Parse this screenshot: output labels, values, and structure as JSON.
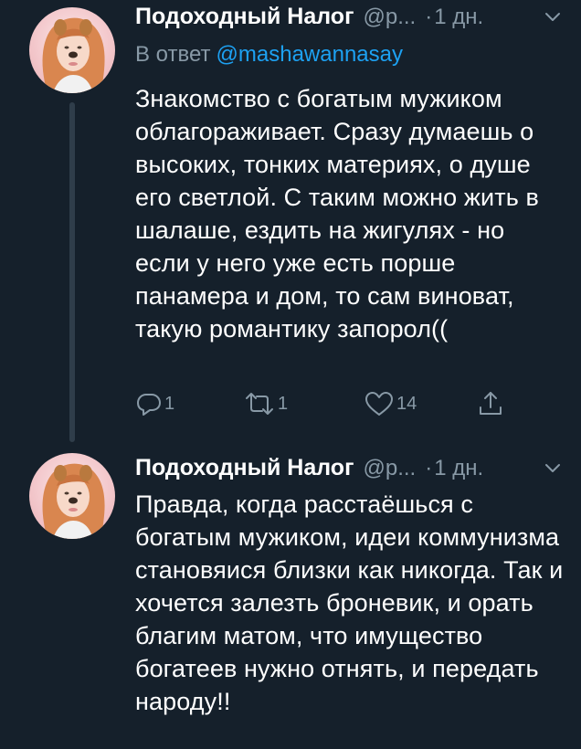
{
  "tweets": [
    {
      "display_name": "Подоходный Налог",
      "handle": "@p...",
      "dot": "·",
      "time": "1 дн.",
      "reply_prefix": "В ответ",
      "reply_mention": "@mashawannasay",
      "text": "Знакомство с богатым мужиком облагораживает. Сразу думаешь о высоких, тонких материях, о душе его светлой. С таким можно жить в шалаше, ездить на жигулях - но если у него уже есть порше панамера и дом, то сам виноват, такую романтику запорол((",
      "reply_count": "1",
      "retweet_count": "1",
      "like_count": "14"
    },
    {
      "display_name": "Подоходный Налог",
      "handle": "@p...",
      "dot": "·",
      "time": "1 дн.",
      "text": "Правда, когда расстаёшься с богатым мужиком, идеи коммунизма становяися близки как никогда. Так и хочется залезть броневик, и орать благим матом, что имущество богатеев нужно отнять, и передать народу!!"
    }
  ],
  "colors": {
    "background": "#15202b",
    "text": "#ffffff",
    "secondary": "#8899a6",
    "accent": "#1da1f2",
    "thread_line": "#2f3d4a"
  },
  "icons": {
    "reply": "reply-icon",
    "retweet": "retweet-icon",
    "like": "heart-icon",
    "share": "share-icon",
    "menu": "chevron-down-icon"
  }
}
